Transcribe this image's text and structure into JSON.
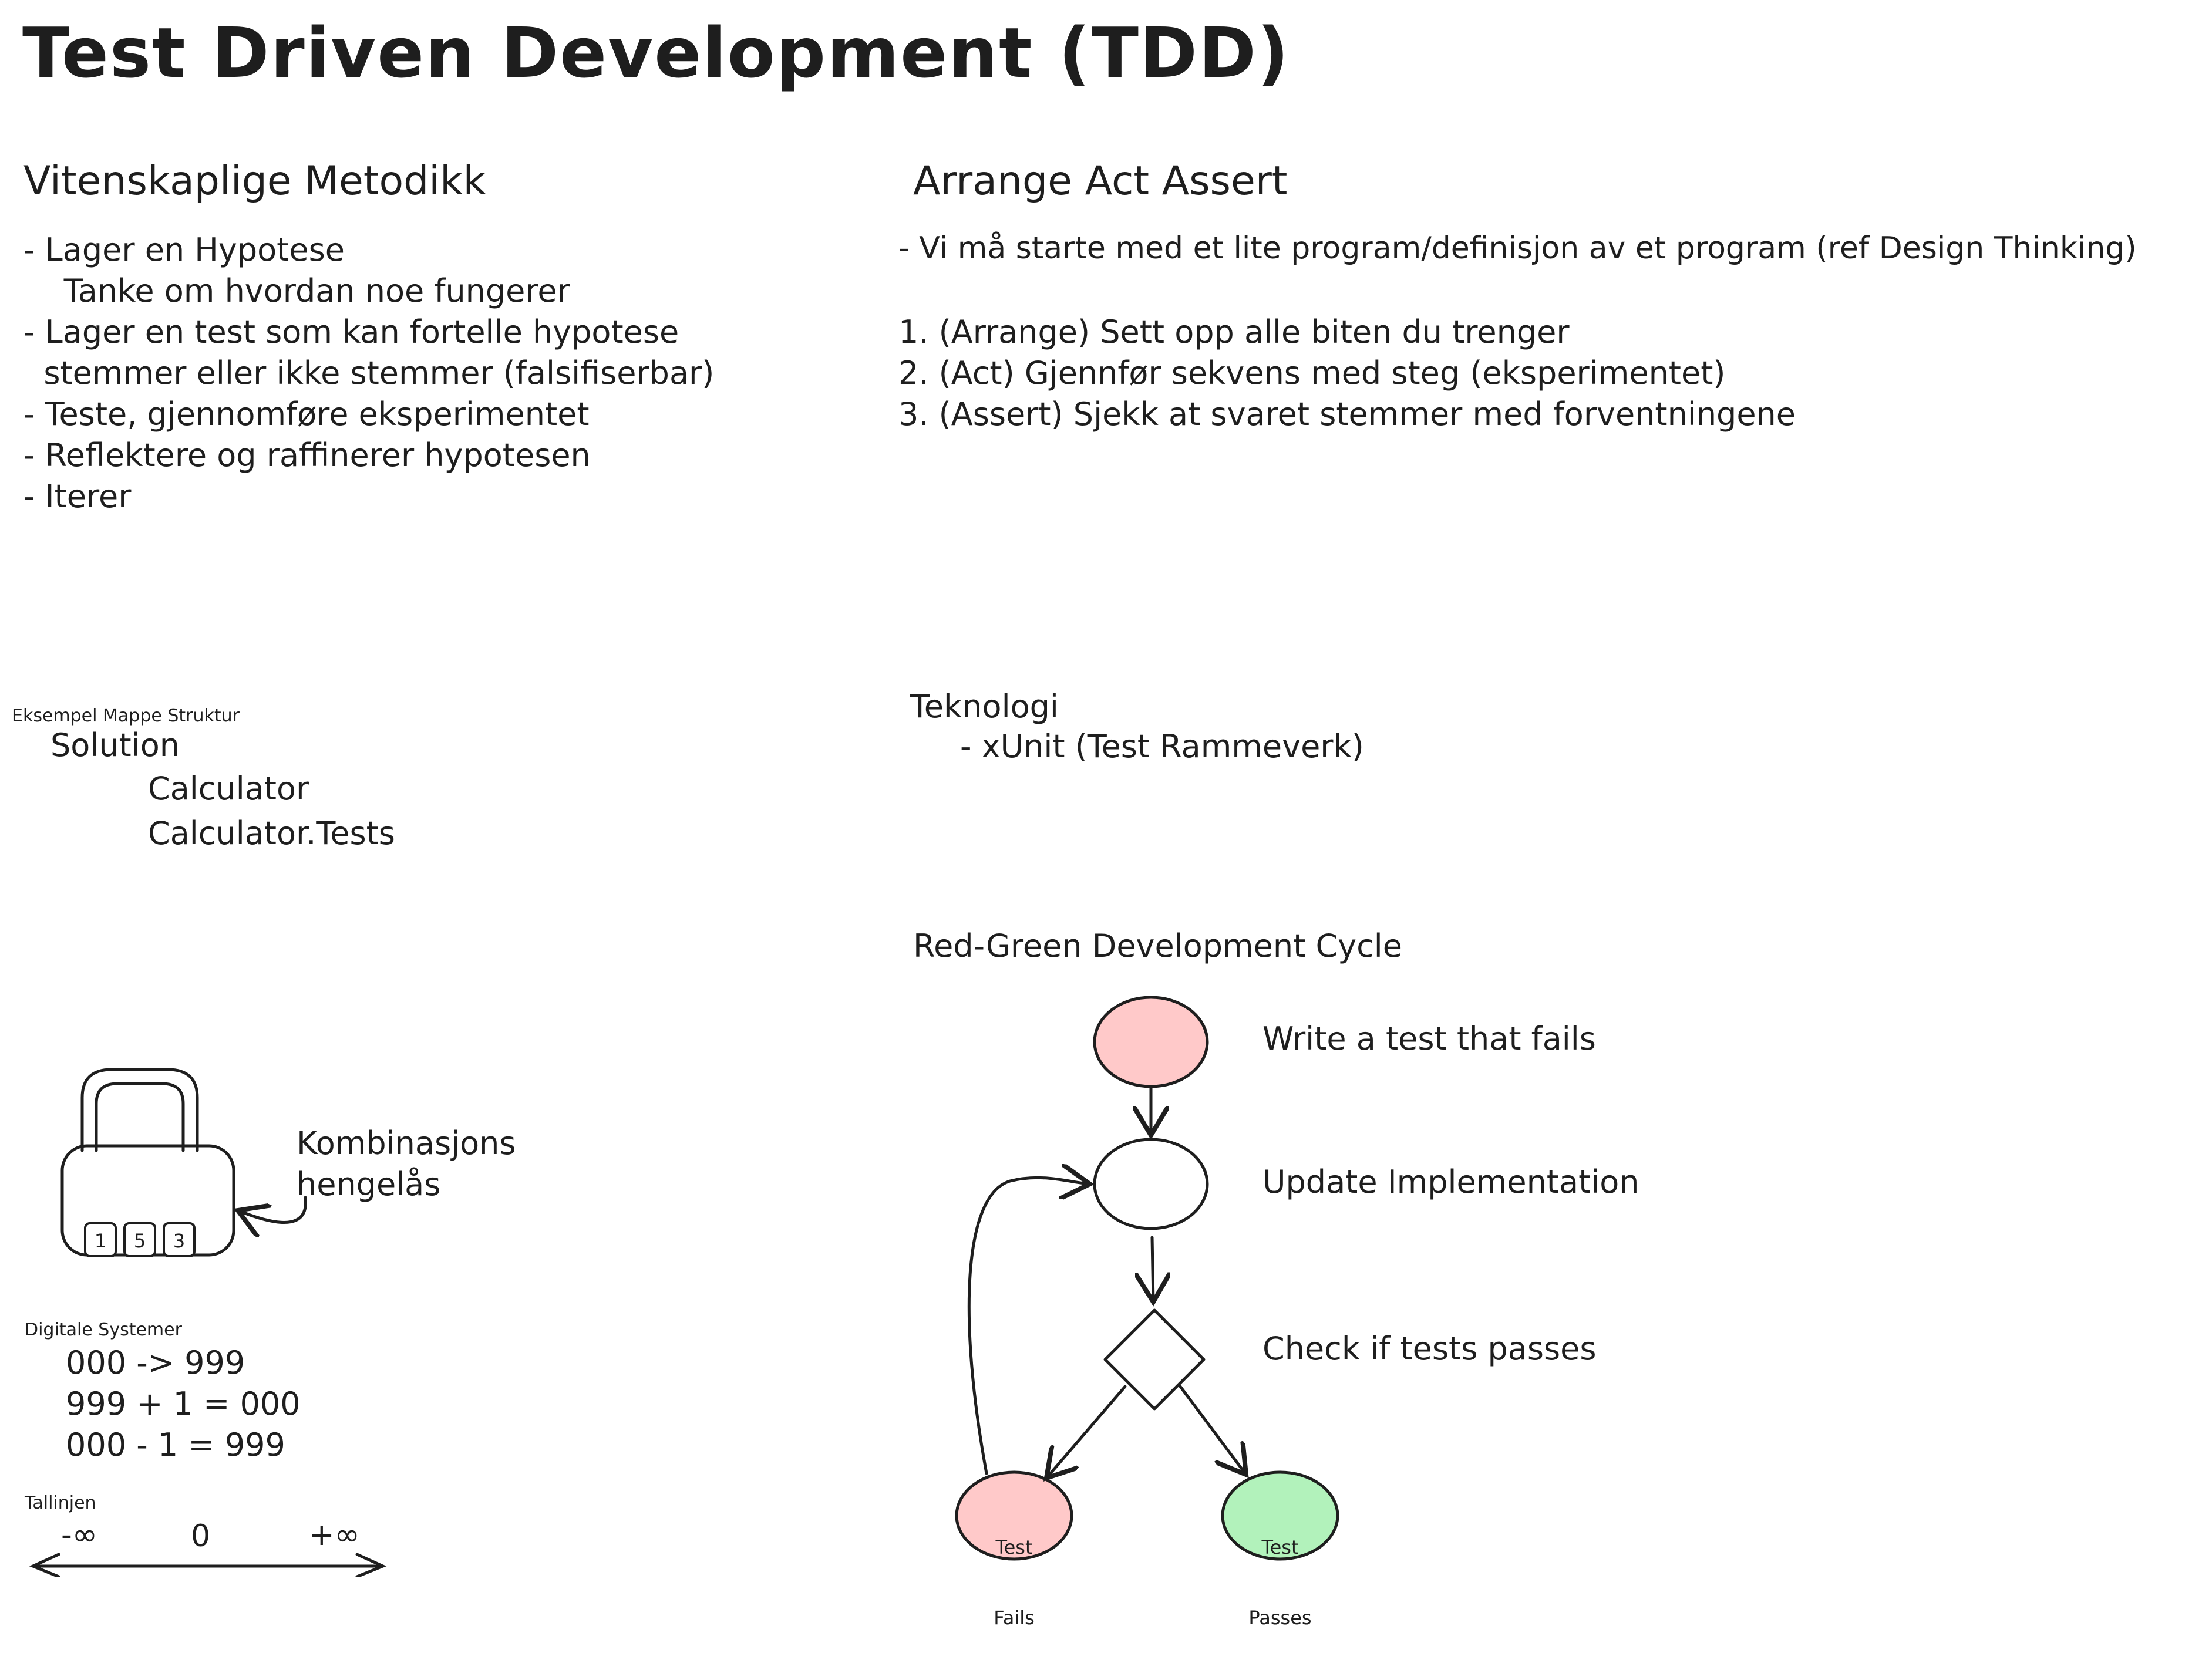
{
  "title": "Test Driven Development (TDD)",
  "scientific_method": {
    "heading": "Vitenskaplige Metodikk",
    "lines": [
      "- Lager en Hypotese",
      "    Tanke om hvordan noe fungerer",
      "- Lager en test som kan fortelle hypotese",
      "  stemmer eller ikke stemmer (falsifiserbar)",
      "- Teste, gjennomføre eksperimentet",
      "- Reflektere og raffinerer hypotesen",
      "- Iterer"
    ]
  },
  "aaa": {
    "heading": "Arrange Act Assert",
    "intro": "- Vi må starte med et lite program/definisjon av et program (ref Design Thinking)",
    "steps": [
      "1. (Arrange) Sett opp alle biten du trenger",
      "2. (Act) Gjennfør sekvens med steg (eksperimentet)",
      "3. (Assert) Sjekk at svaret stemmer med forventningene"
    ]
  },
  "folder_structure": {
    "label": "Eksempel Mappe Struktur",
    "root": "Solution",
    "children": [
      "Calculator",
      "Calculator.Tests"
    ]
  },
  "technology": {
    "heading": "Teknologi",
    "items": [
      "- xUnit (Test Rammeverk)"
    ]
  },
  "padlock": {
    "label_lines": [
      "Kombinasjons",
      "hengelås"
    ],
    "digits": [
      "1",
      "5",
      "3"
    ]
  },
  "digital_systems": {
    "label": "Digitale Systemer",
    "lines": [
      "000 -> 999",
      "999 + 1 = 000",
      "000 - 1 = 999"
    ]
  },
  "number_line": {
    "label": "Tallinjen",
    "ticks": [
      "-∞",
      "0",
      "+∞"
    ]
  },
  "cycle": {
    "heading": "Red-Green Development Cycle",
    "steps": [
      "Write a test that fails",
      "Update Implementation",
      "Check if tests passes"
    ],
    "fail_node": [
      "Test",
      "Fails"
    ],
    "pass_node": [
      "Test",
      "Passes"
    ],
    "colors": {
      "fail_fill": "#ffc9c9",
      "pass_fill": "#b2f2bb",
      "stroke": "#1e1e1e"
    }
  }
}
